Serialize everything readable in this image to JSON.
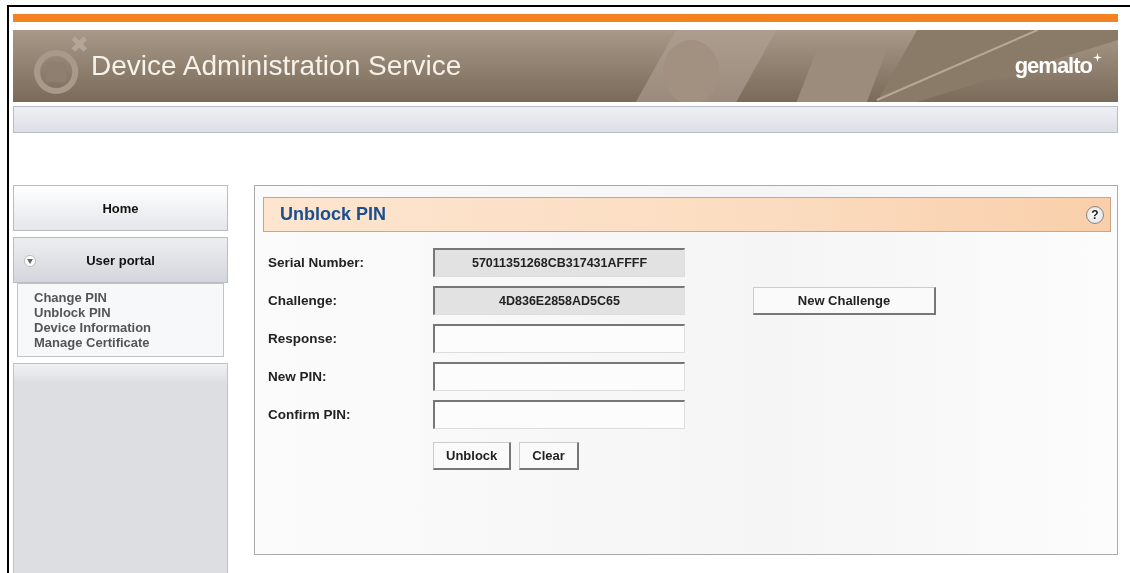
{
  "header": {
    "title": "Device Administration Service",
    "logo": "gemalto"
  },
  "sidebar": {
    "home": "Home",
    "section": {
      "label": "User portal",
      "expanded": true
    },
    "items": [
      {
        "label": "Change PIN"
      },
      {
        "label": "Unblock PIN"
      },
      {
        "label": "Device Information"
      },
      {
        "label": "Manage Certificate"
      }
    ]
  },
  "panel": {
    "title": "Unblock PIN",
    "help": "?",
    "fields": [
      {
        "label": "Serial Number:",
        "value": "57011351268CB317431AFFFF",
        "readonly": true
      },
      {
        "label": "Challenge:",
        "value": "4D836E2858AD5C65",
        "readonly": true,
        "button": "New Challenge"
      },
      {
        "label": "Response:",
        "readonly": false
      },
      {
        "label": "New PIN:",
        "readonly": false
      },
      {
        "label": "Confirm PIN:",
        "readonly": false
      }
    ],
    "buttons": [
      "Unblock",
      "Clear"
    ]
  }
}
